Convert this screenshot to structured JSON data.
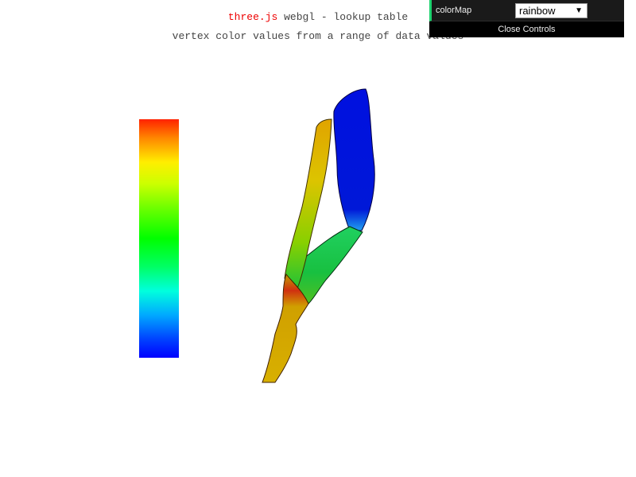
{
  "info": {
    "link_text": "three.js",
    "line1_rest": " webgl - lookup table",
    "line2": "vertex color values from a range of data values"
  },
  "gui": {
    "colormap_label": "colorMap",
    "colormap_value": "rainbow",
    "close_label": "Close Controls"
  },
  "colors": {
    "link": "#ee0000",
    "gui_accent": "#1ed36f",
    "legend_top": "#ff2200",
    "legend_bottom": "#0000ff"
  },
  "icons": {
    "select_arrow": "chevron-down-icon"
  }
}
